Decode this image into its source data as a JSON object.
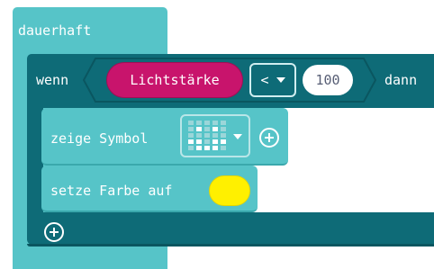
{
  "forever_block": {
    "label": "dauerhaft"
  },
  "if_block": {
    "if_label": "wenn",
    "then_label": "dann",
    "condition": {
      "sensor": "Lichtstärke",
      "operator": "<",
      "value": "100"
    }
  },
  "show_icon_block": {
    "label": "zeige Symbol",
    "icon": "smiley-icon"
  },
  "set_color_block": {
    "label": "setze Farbe auf",
    "color": "#fff000"
  },
  "colors": {
    "forever": "#56c4c8",
    "logic": "#0e6b77",
    "sensor": "#c8146c",
    "swatch": "#fff000"
  }
}
